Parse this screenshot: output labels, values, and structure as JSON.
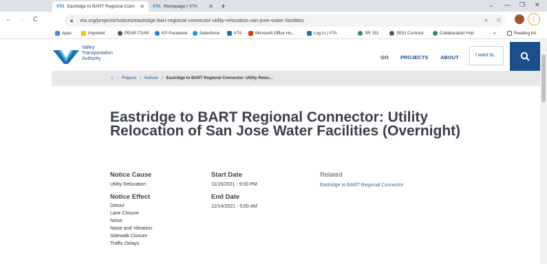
{
  "browser": {
    "tabs": [
      {
        "title": "Eastridge to BART Regional Conn",
        "active": true
      },
      {
        "title": "Homepage | VTA",
        "active": false
      }
    ],
    "tab_favicon": "VTA",
    "url": "vta.org/projects/notices/eastridge-bart-regional-connector-utility-relocation-san-jose-water-facilities",
    "bookmarks": [
      {
        "label": "Apps",
        "color": "#4285f4"
      },
      {
        "label": "Imported",
        "color": "#f4c20d"
      },
      {
        "label": "PEAR-TSAR",
        "color": "#555555"
      },
      {
        "label": "KP-Facebook",
        "color": "#1877f2"
      },
      {
        "label": "Salesforce",
        "color": "#00a1e0"
      },
      {
        "label": "VTA",
        "color": "#1a6fb5"
      },
      {
        "label": "Microsoft Office Ho...",
        "color": "#d83b01"
      },
      {
        "label": "Log in | VTA",
        "color": "#1a6fb5"
      },
      {
        "label": "SR 152",
        "color": "#2e8b57"
      },
      {
        "label": "SEIU Contract",
        "color": "#555555"
      },
      {
        "label": "Collaboration Hub",
        "color": "#2e8b57"
      }
    ],
    "bookmarks_overflow": "»",
    "reading_list": "Reading list"
  },
  "site": {
    "logo_lines": [
      "Valley",
      "Transportation",
      "Authority"
    ],
    "nav": [
      "GO",
      "PROJECTS",
      "ABOUT"
    ],
    "i_want_to": "I want to...",
    "brand_color": "#1a4f8b"
  },
  "breadcrumb": {
    "items": [
      "Projects",
      "Notices"
    ],
    "current": "Eastridge to BART Regional Connector: Utility Reloc..."
  },
  "notice": {
    "title": "Eastridge to BART Regional Connector: Utility Relocation of San Jose Water Facilities (Overnight)",
    "cause_label": "Notice Cause",
    "cause_value": "Utility Relocation",
    "effect_label": "Notice Effect",
    "effects": [
      "Detour",
      "Lane Closure",
      "Noise",
      "Noise and Vibration",
      "Sidewalk Closure",
      "Traffic Delays"
    ],
    "start_label": "Start Date",
    "start_value": "11/15/2021 - 9:00 PM",
    "end_label": "End Date",
    "end_value": "12/14/2021 - 5:00 AM",
    "related_label": "Related",
    "related_link": "Eastridge to BART Regional Connector"
  }
}
